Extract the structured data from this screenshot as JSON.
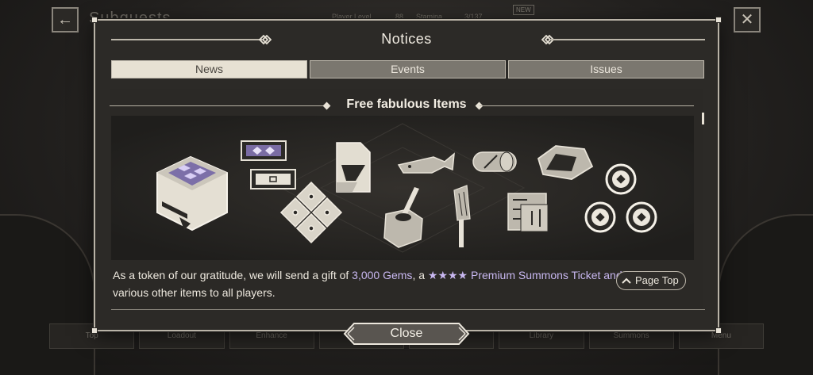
{
  "background": {
    "screen_title": "Subquests",
    "player_level_label": "Player Level",
    "player_level": "88",
    "stamina_label": "Stamina",
    "stamina": "3/137",
    "new_badge": "NEW",
    "nav": [
      "Top",
      "Loadout",
      "Enhance",
      "",
      "on",
      "Library",
      "Summons",
      "Menu"
    ]
  },
  "modal": {
    "title": "Notices",
    "tabs": [
      {
        "label": "News",
        "active": true
      },
      {
        "label": "Events",
        "active": false
      },
      {
        "label": "Issues",
        "active": false
      }
    ],
    "section_title": "Free fabulous Items",
    "body_prefix": "As a token of our gratitude, we will send a gift of ",
    "body_gems": "3,000 Gems",
    "body_mid": ", a ",
    "body_ticket": "★★★★ Premium Summons Tic",
    "body_ticket_tail": "ket and",
    "body_line2": "various other items to all players.",
    "page_top_label": "Page Top",
    "close_label": "Close"
  },
  "colors": {
    "accent_highlight": "#c8b7f0",
    "tab_active": "#e7e1d3",
    "tab_inactive": "#7b776f"
  }
}
